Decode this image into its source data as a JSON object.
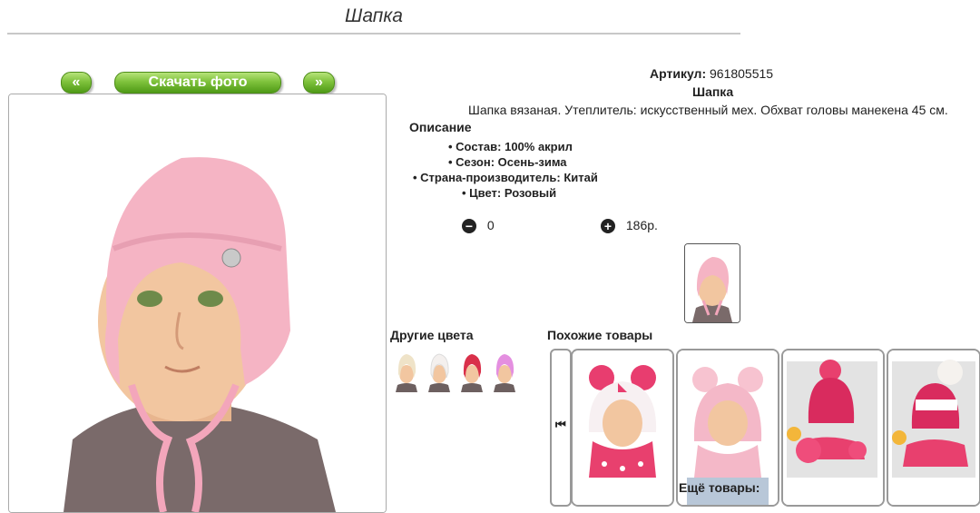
{
  "page": {
    "title": "Шапка"
  },
  "gallery": {
    "prev_label": "«",
    "download_label": "Скачать фото",
    "next_label": "»"
  },
  "product": {
    "article_label": "Артикул:",
    "article_value": "961805515",
    "name": "Шапка",
    "summary": "Шапка вязаная. Утеплитель: искусственный мех. Обхват головы манекена 45 см.",
    "description_heading": "Описание",
    "specs": [
      "Состав: 100% акрил",
      "Сезон: Осень-зима",
      "Страна-производитель: Китай",
      "Цвет: Розовый"
    ],
    "quantity": "0",
    "price": "186р."
  },
  "other_colors": {
    "heading": "Другие цвета"
  },
  "similar": {
    "heading": "Похожие товары",
    "more_label": "Ещё товары:"
  },
  "colors": {
    "accent_green": "#7fc23c",
    "hat_pink": "#f5b4c4",
    "swatch_cream": "#efe3c8",
    "swatch_red": "#d9304a",
    "swatch_violet": "#e48fe0"
  }
}
